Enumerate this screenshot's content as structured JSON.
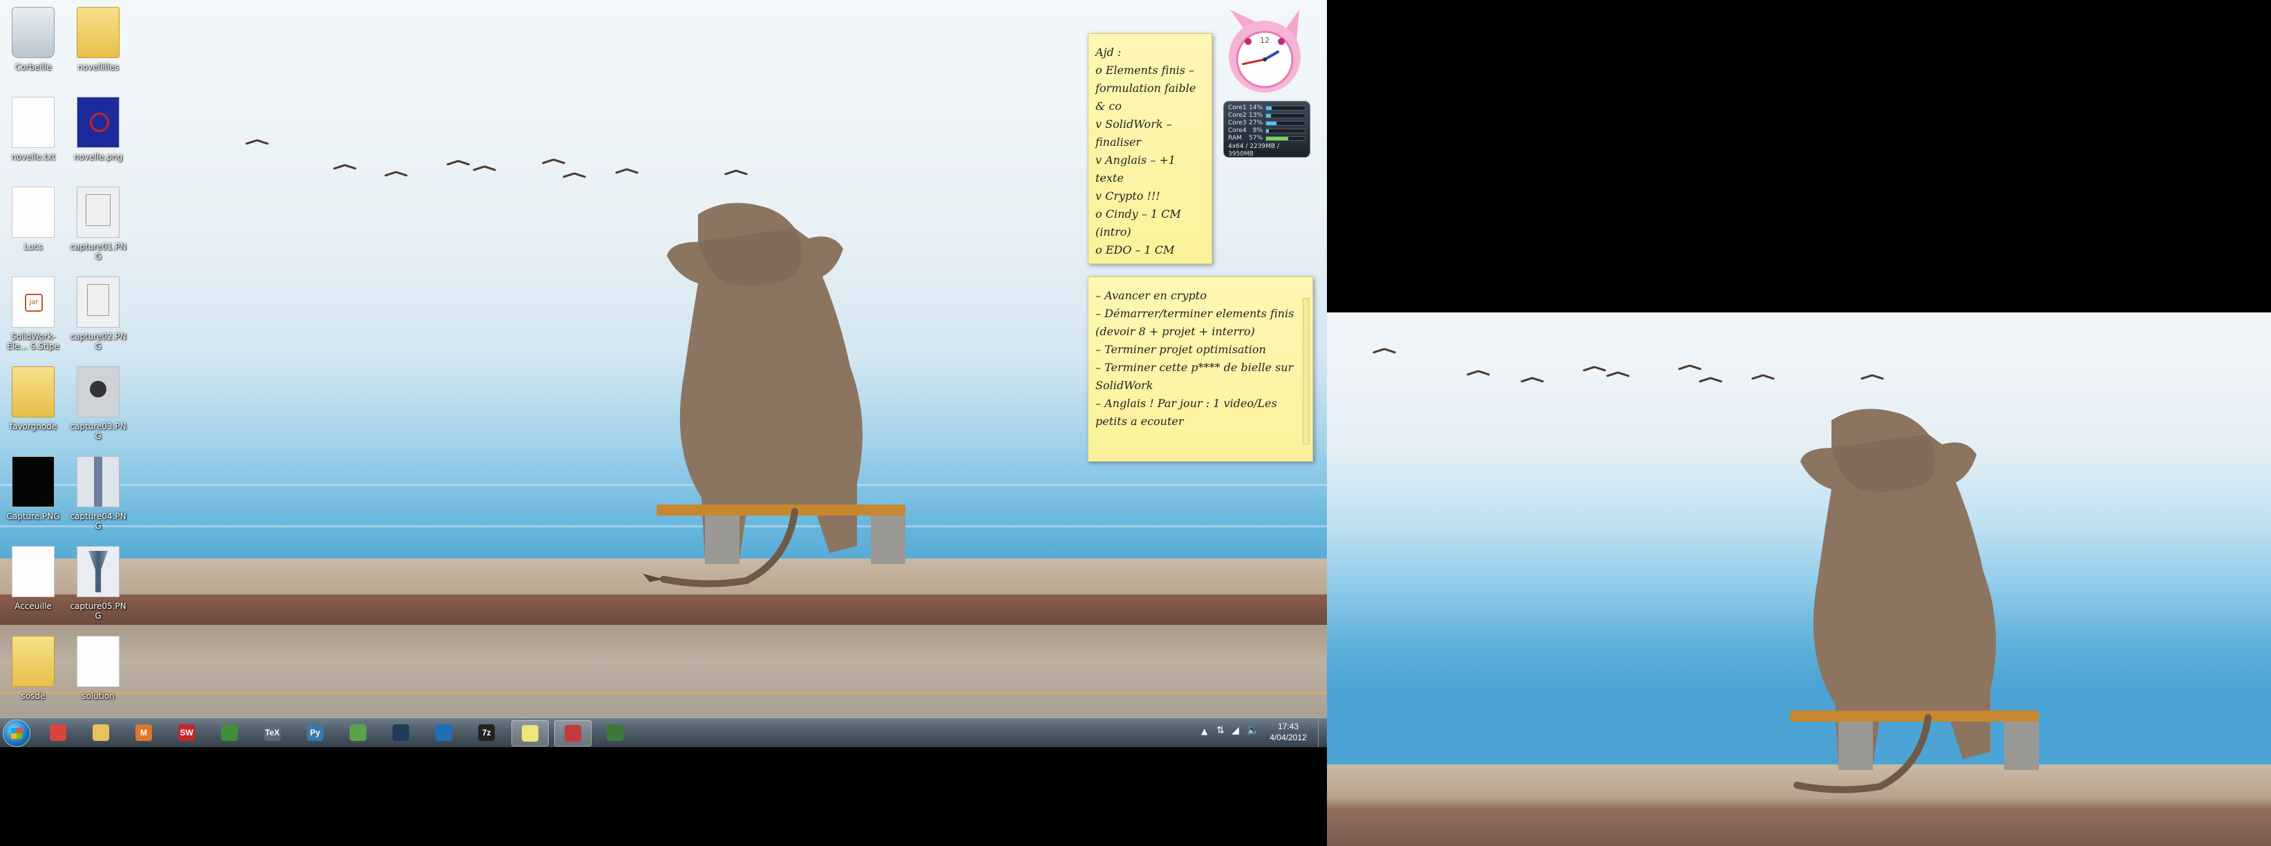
{
  "desktop": {
    "icons": [
      {
        "label": "Corbeille",
        "kind": "bin"
      },
      {
        "label": "novellilles",
        "kind": "folder"
      },
      {
        "label": "novelle.txt",
        "kind": "doc"
      },
      {
        "label": "novelle.png",
        "kind": "thumb-blue"
      },
      {
        "label": "Lucs",
        "kind": "doc"
      },
      {
        "label": "capture01.PNG",
        "kind": "thumb"
      },
      {
        "label": "SolidWork-Ele... S.Stipe",
        "kind": "doc-jar"
      },
      {
        "label": "capture02.PNG",
        "kind": "thumb"
      },
      {
        "label": "favorgnode",
        "kind": "folder"
      },
      {
        "label": "capture03.PNG",
        "kind": "thumb-dark"
      },
      {
        "label": "Capture.PNG",
        "kind": "thumb-black"
      },
      {
        "label": "capture04.PNG",
        "kind": "thumb-strip"
      },
      {
        "label": "Acceuille",
        "kind": "doc"
      },
      {
        "label": "capture05.PNG",
        "kind": "thumb-funnel"
      },
      {
        "label": "sosde",
        "kind": "folder"
      },
      {
        "label": "solution",
        "kind": "doc"
      }
    ]
  },
  "sticky_notes": [
    {
      "lines": [
        "Ajd :",
        "o Elements finis – formulation faible & co",
        "v  SolidWork – finaliser",
        "v Anglais – +1 texte",
        "v Crypto !!!",
        "o Cindy – 1 CM (intro)",
        "o EDO – 1 CM"
      ]
    },
    {
      "lines": [
        "– Avancer en crypto",
        "– Démarrer/terminer elements finis (devoir 8 + projet + interro)",
        "– Terminer projet optimisation",
        "– Terminer cette p**** de bielle sur SolidWork",
        "– Anglais ! Par jour : 1 video/Les petits a ecouter"
      ]
    }
  ],
  "cpu_gadget": {
    "rows": [
      {
        "name": "Core1",
        "value": "14%",
        "pct": 14
      },
      {
        "name": "Core2",
        "value": "13%",
        "pct": 13
      },
      {
        "name": "Core3",
        "value": "27%",
        "pct": 27
      },
      {
        "name": "Core4",
        "value": "8%",
        "pct": 8
      },
      {
        "name": "RAM",
        "value": "57%",
        "pct": 57
      }
    ],
    "footer": "4x64 / 2239MB / 3950MB"
  },
  "clock_gadget": {
    "numeral": "12",
    "hour_angle": 60,
    "minute_angle": 258
  },
  "taskbar": {
    "items": [
      {
        "name": "chrome",
        "glyph": "",
        "color": "#d9453c",
        "active": false
      },
      {
        "name": "explorer",
        "glyph": "",
        "color": "#e8c25a",
        "active": false
      },
      {
        "name": "matlab",
        "glyph": "M",
        "color": "#e0762a",
        "active": false
      },
      {
        "name": "solidworks",
        "glyph": "SW",
        "color": "#c4252a",
        "active": false
      },
      {
        "name": "office",
        "glyph": "",
        "color": "#3f8e3a",
        "active": false
      },
      {
        "name": "tex",
        "glyph": "TeX",
        "color": "#5b6b78",
        "active": false
      },
      {
        "name": "python",
        "glyph": "Py",
        "color": "#3b77a8",
        "active": false
      },
      {
        "name": "notepad",
        "glyph": "",
        "color": "#5aa34b",
        "active": false
      },
      {
        "name": "steam",
        "glyph": "",
        "color": "#1f3b57",
        "active": false
      },
      {
        "name": "wireshark",
        "glyph": "",
        "color": "#1f6fb7",
        "active": false
      },
      {
        "name": "7zip",
        "glyph": "7z",
        "color": "#222",
        "active": false
      },
      {
        "name": "sticky-notes",
        "glyph": "",
        "color": "#f1e47a",
        "active": true
      },
      {
        "name": "gadgets",
        "glyph": "",
        "color": "#c23b3b",
        "active": true
      },
      {
        "name": "cmd",
        "glyph": "",
        "color": "#3a7a3a",
        "active": false
      }
    ],
    "time": "17:43",
    "date": "4/04/2012"
  }
}
